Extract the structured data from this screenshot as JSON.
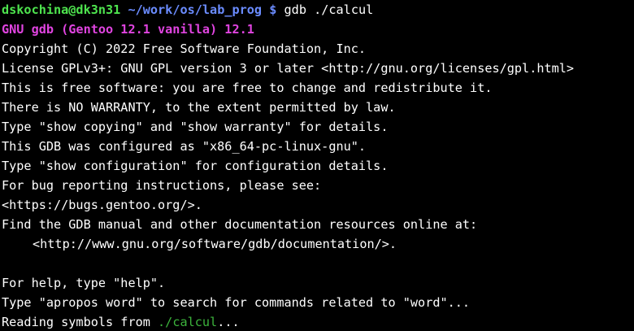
{
  "colors": {
    "background": "#000000",
    "text": "#ffffff",
    "user_host": "#4ee44e",
    "cwd": "#6b8cff",
    "gdb_banner": "#e044e0",
    "file_path": "#3cb43c"
  },
  "prompt": {
    "user_host": "dskochina@dk3n31",
    "cwd": "~/work/os/lab_prog",
    "symbol": "$",
    "command": "gdb ./calcul"
  },
  "output": {
    "banner": "GNU gdb (Gentoo 12.1 vanilla) 12.1",
    "copyright": "Copyright (C) 2022 Free Software Foundation, Inc.",
    "license": "License GPLv3+: GNU GPL version 3 or later <http://gnu.org/licenses/gpl.html>",
    "free_software": "This is free software: you are free to change and redistribute it.",
    "warranty": "There is NO WARRANTY, to the extent permitted by law.",
    "show_copying": "Type \"show copying\" and \"show warranty\" for details.",
    "configured_as": "This GDB was configured as \"x86_64-pc-linux-gnu\".",
    "show_configuration": "Type \"show configuration\" for configuration details.",
    "bug_reporting": "For bug reporting instructions, please see:",
    "bug_url": "<https://bugs.gentoo.org/>.",
    "find_manual": "Find the GDB manual and other documentation resources online at:",
    "doc_url": "<http://www.gnu.org/software/gdb/documentation/>.",
    "help": "For help, type \"help\".",
    "apropos": "Type \"apropos word\" to search for commands related to \"word\"...",
    "reading_prefix": "Reading symbols from ",
    "reading_file": "./calcul",
    "reading_suffix": "..."
  }
}
